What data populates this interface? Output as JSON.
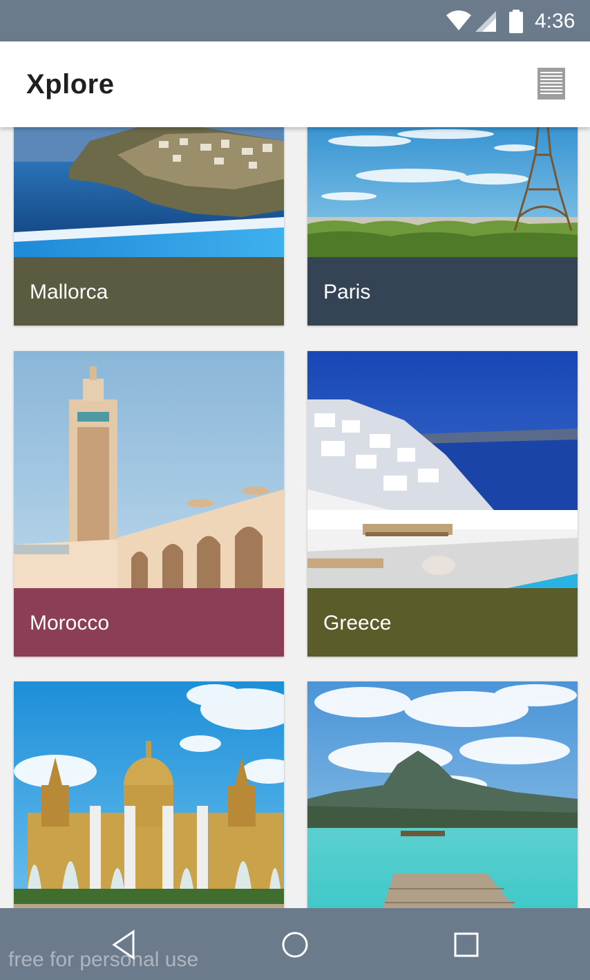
{
  "status_bar": {
    "time": "4:36",
    "icons": [
      "wifi-icon",
      "signal-icon",
      "battery-icon"
    ]
  },
  "app_bar": {
    "title": "Xplore",
    "menu_icon": "menu-list-icon"
  },
  "destinations": [
    {
      "name": "Mallorca",
      "label_color": "#5a5b40",
      "image": "coastal-cliff-photo"
    },
    {
      "name": "Paris",
      "label_color": "#344454",
      "image": "eiffel-tower-photo"
    },
    {
      "name": "Morocco",
      "label_color": "#8b3e54",
      "image": "minaret-mosque-photo"
    },
    {
      "name": "Greece",
      "label_color": "#5a5c2a",
      "image": "santorini-terrace-photo"
    },
    {
      "name": "",
      "label_color": "",
      "image": "palace-fountains-photo"
    },
    {
      "name": "",
      "label_color": "",
      "image": "tropical-lagoon-photo"
    }
  ],
  "nav_bar": {
    "buttons": [
      "back-icon",
      "home-icon",
      "recents-icon"
    ]
  },
  "watermark": "free for personal use",
  "colors": {
    "bars": "#6b7b8c",
    "background": "#f1f1f1"
  }
}
